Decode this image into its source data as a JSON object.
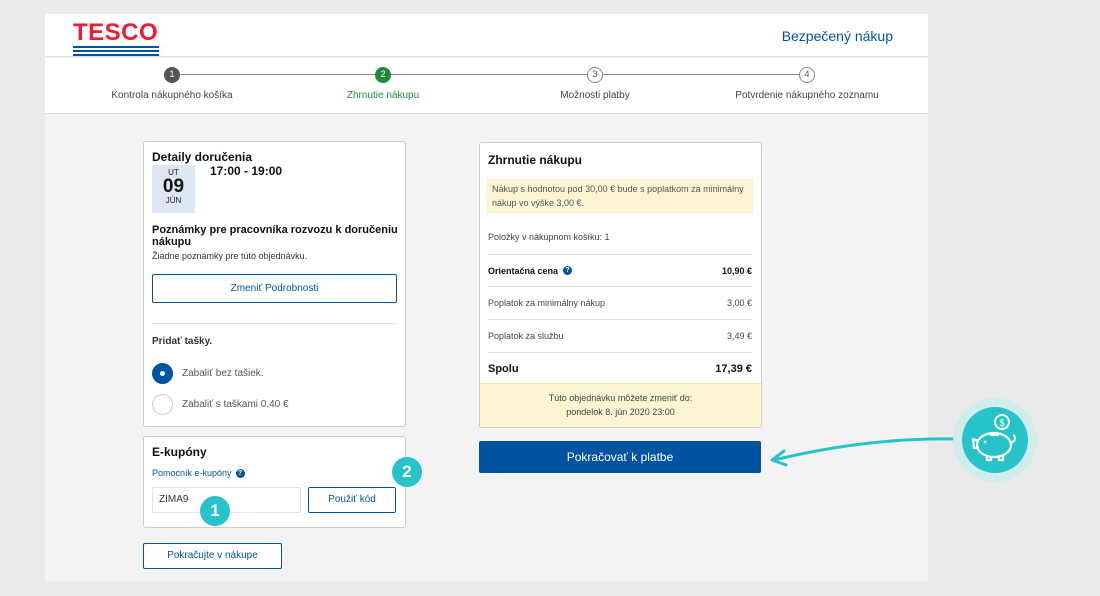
{
  "brand": {
    "name": "TESCO",
    "secure_label": "Bezpečený nákup"
  },
  "steps": [
    {
      "num": "1",
      "label": "Kontrola nákupného košíka"
    },
    {
      "num": "2",
      "label": "Zhrnutie nákupu"
    },
    {
      "num": "3",
      "label": "Možnosti platby"
    },
    {
      "num": "4",
      "label": "Potvrdenie nákupného zoznamu"
    }
  ],
  "delivery": {
    "title": "Detaily doručenia",
    "date": {
      "dow": "UT",
      "day": "09",
      "month": "JÚN"
    },
    "time": "17:00 - 19:00",
    "notes_title": "Poznámky pre pracovníka rozvozu k doručeniu nákupu",
    "notes_text": "Žiadne poznámky pre túto objednávku.",
    "change_button": "Zmeniť Podrobnosti",
    "bags_title": "Pridať tašky.",
    "bag_options": [
      "Zabaliť bez tašiek.",
      "Zabaliť s taškami 0,40 €"
    ]
  },
  "coupons": {
    "title": "E-kupóny",
    "helper": "Pomocník e-kupóny",
    "code_value": "ZIMA9",
    "apply_button": "Použiť kód"
  },
  "continue_button": "Pokračujte v nákupe",
  "badges": [
    "1",
    "2"
  ],
  "summary": {
    "title": "Zhrnutie nákupu",
    "notice": "Nákup s hodnotou pod 30,00 € bude s poplatkom za minimálny nákup vo výške 3,00 €.",
    "items": "Položky v nákupnom košíku:  1",
    "rows": [
      {
        "label": "Orientačná cena",
        "value": "10,90 €"
      },
      {
        "label": "Poplatok za minimálny nákup",
        "value": "3,00 €"
      },
      {
        "label": "Poplatok za službu",
        "value": "3,49 €"
      },
      {
        "label": "Spolu",
        "value": "17,39 €"
      }
    ],
    "change_note_line1": "Túto objednávku môžete zmeniť do:",
    "change_note_line2": "pondelok 8. jún 2020 23:00"
  },
  "pay_button": "Pokračovať k platbe",
  "colors": {
    "brand_blue": "#00539f",
    "tesco_red": "#ee1c2e",
    "accent_teal": "#27c3c9",
    "step_green": "#1f8a3a"
  },
  "icons": [
    "help-icon",
    "piggy-bank-icon",
    "arrow-icon"
  ]
}
